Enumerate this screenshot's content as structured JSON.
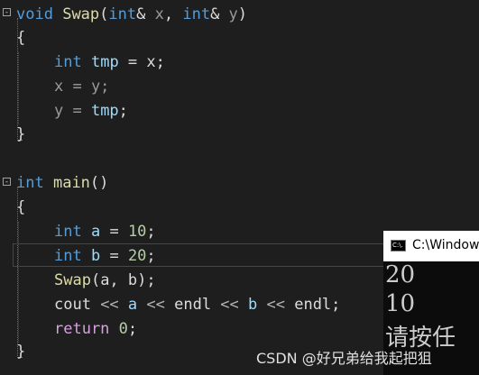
{
  "editor": {
    "lines": {
      "l1": {
        "kw_void": "void",
        "fn_swap": "Swap",
        "p1": "(",
        "kw_int1": "int",
        "p2": "& ",
        "param_x": "x",
        "p3": ", ",
        "kw_int2": "int",
        "p4": "& ",
        "param_y": "y",
        "p5": ")"
      },
      "l2": {
        "brace": "{"
      },
      "l3": {
        "kw_int": "int",
        "var": "tmp",
        "rest": " = x;"
      },
      "l4": {
        "text": "x = y;"
      },
      "l5": {
        "a": "y = ",
        "var": "tmp",
        "b": ";"
      },
      "l6": {
        "brace": "}"
      },
      "l7": {
        "kw_int": "int",
        "fn_main": "main",
        "rest": "()"
      },
      "l8": {
        "brace": "{"
      },
      "l9": {
        "kw_int": "int",
        "var": "a",
        "eq": " = ",
        "num": "10",
        "semi": ";"
      },
      "l10": {
        "kw_int": "int",
        "var": "b",
        "eq": " = ",
        "num": "20",
        "semi": ";"
      },
      "l11": {
        "fn": "Swap",
        "rest": "(a, b);"
      },
      "l12": {
        "cout": "cout",
        "op1": " << ",
        "a": "a",
        "op2": " << ",
        "endl1": "endl",
        "op3": " << ",
        "b": "b",
        "op4": " << ",
        "endl2": "endl",
        "semi": ";"
      },
      "l13": {
        "kw_return": "return",
        "num": "0",
        "semi": ";"
      },
      "l14": {
        "brace": "}"
      }
    },
    "fold_markers": {
      "collapse": "-"
    }
  },
  "console": {
    "title": "C:\\Windows",
    "icon_text": "C:\\.",
    "lines": [
      "20",
      "10",
      "请按任"
    ]
  },
  "watermark": "CSDN @好兄弟给我起把狙",
  "colors": {
    "background": "#1e1e1e",
    "keyword": "#569cd6",
    "function": "#dcdcaa",
    "variable": "#9cdcfe",
    "number": "#b5cea8",
    "control": "#d8a0df"
  }
}
